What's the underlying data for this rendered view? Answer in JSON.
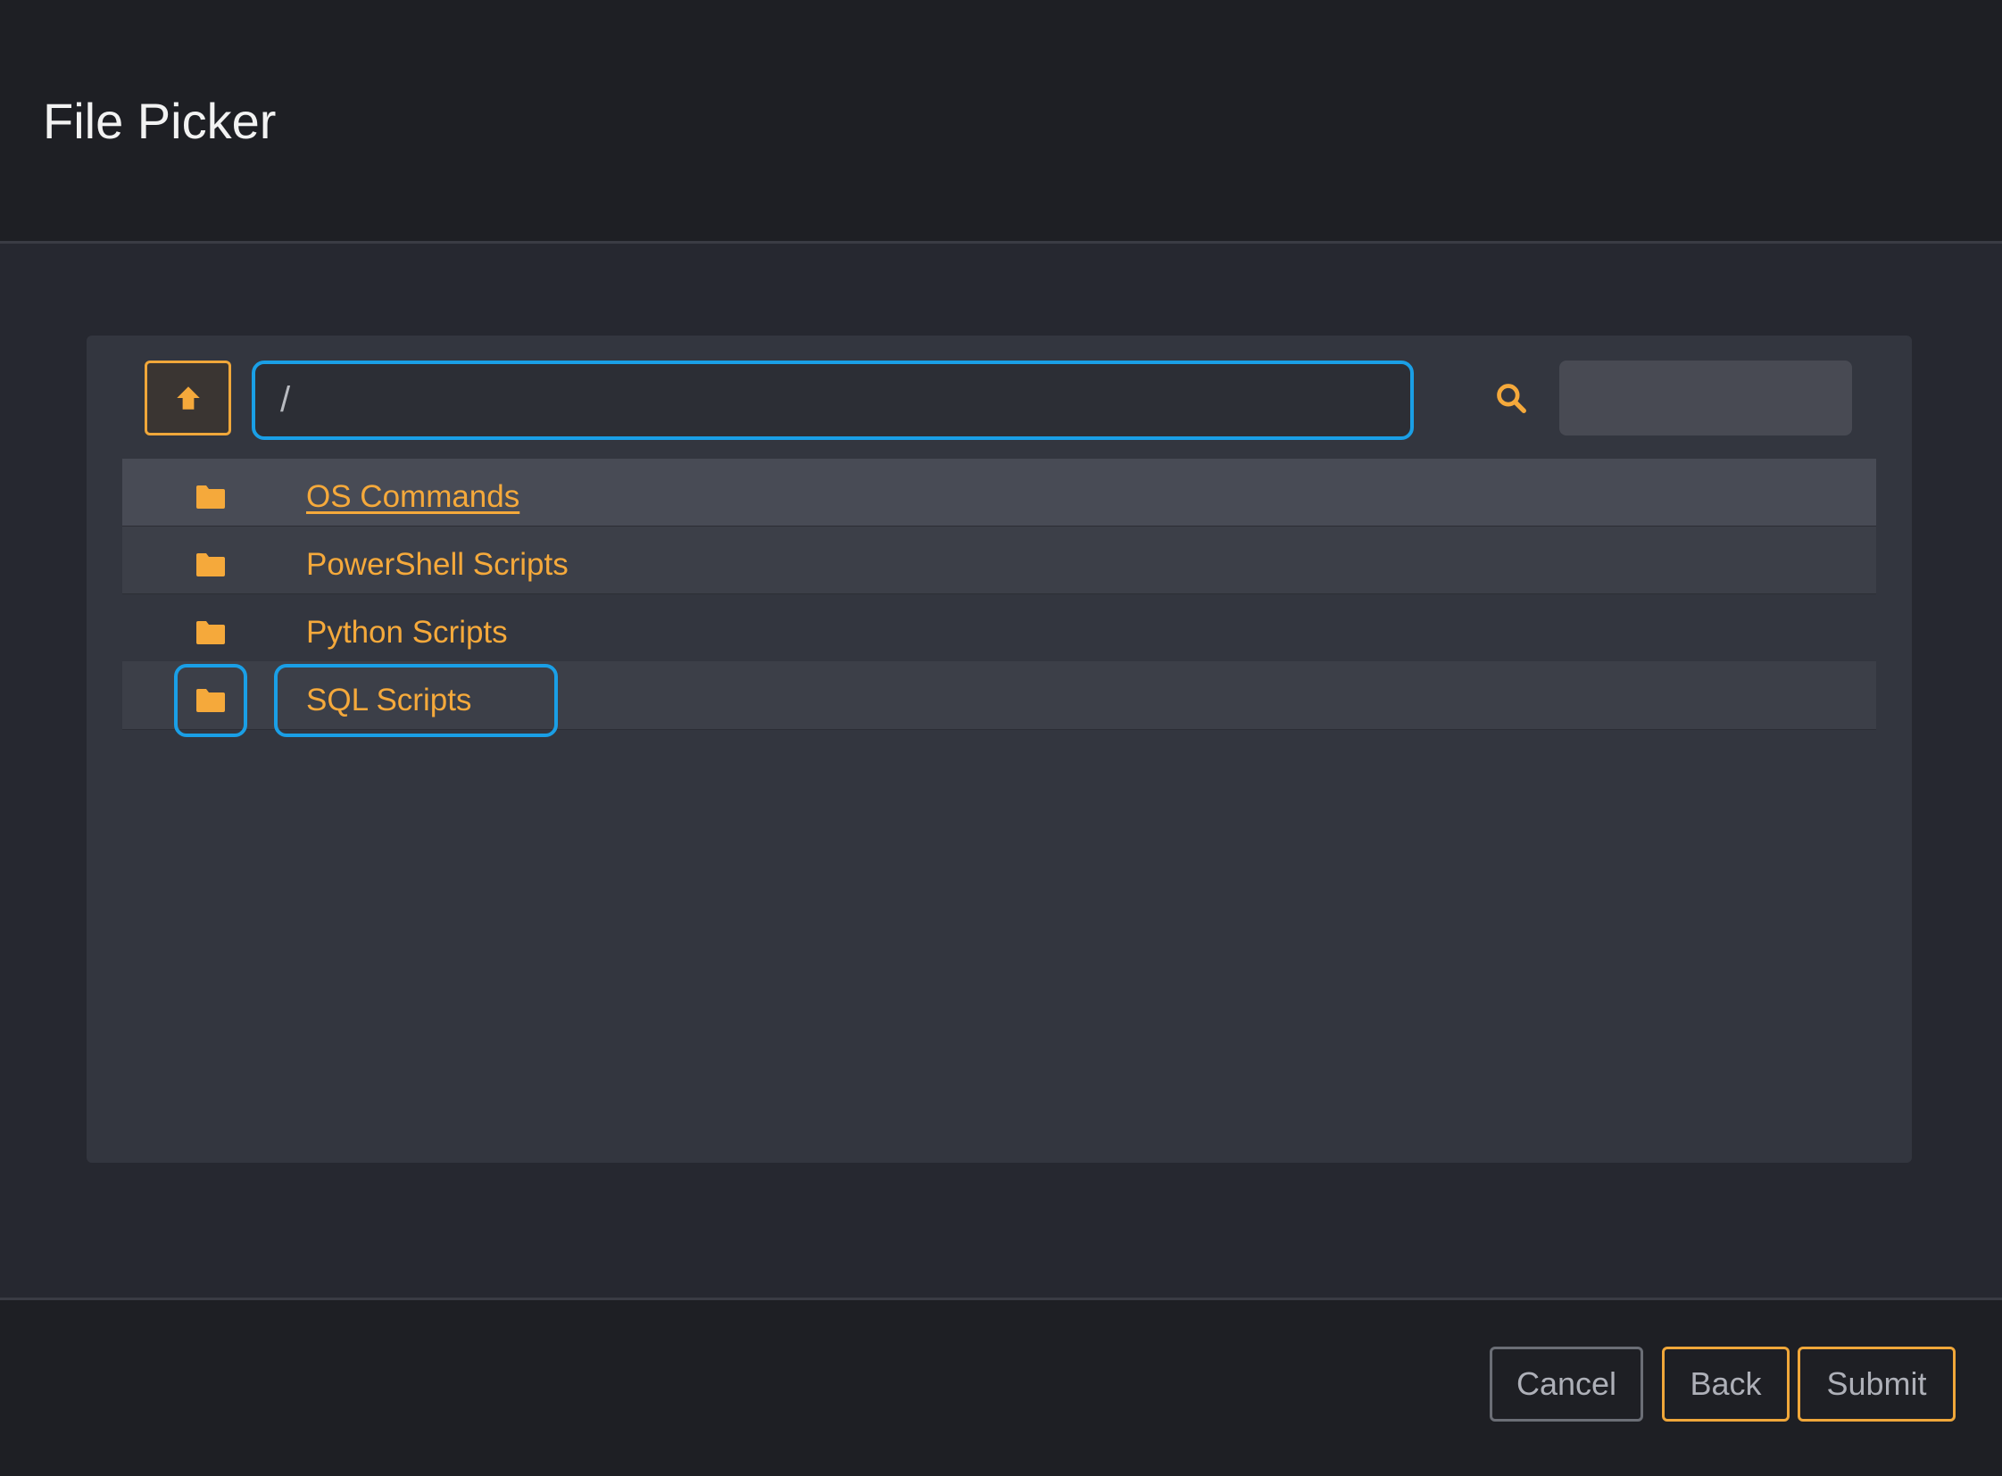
{
  "dialog": {
    "title": "File Picker"
  },
  "toolbar": {
    "up_icon": "arrow-up-icon",
    "path_value": "/",
    "search_icon": "search-icon",
    "search_value": ""
  },
  "folders": [
    {
      "name": "OS Commands",
      "icon": "folder-icon"
    },
    {
      "name": "PowerShell Scripts",
      "icon": "folder-icon"
    },
    {
      "name": "Python Scripts",
      "icon": "folder-icon"
    },
    {
      "name": "SQL Scripts",
      "icon": "folder-icon"
    }
  ],
  "footer": {
    "cancel_label": "Cancel",
    "back_label": "Back",
    "submit_label": "Submit"
  },
  "colors": {
    "accent": "#f5a93b",
    "focus": "#1a9fe6",
    "background": "#1e1f24",
    "panel": "#33363f"
  }
}
